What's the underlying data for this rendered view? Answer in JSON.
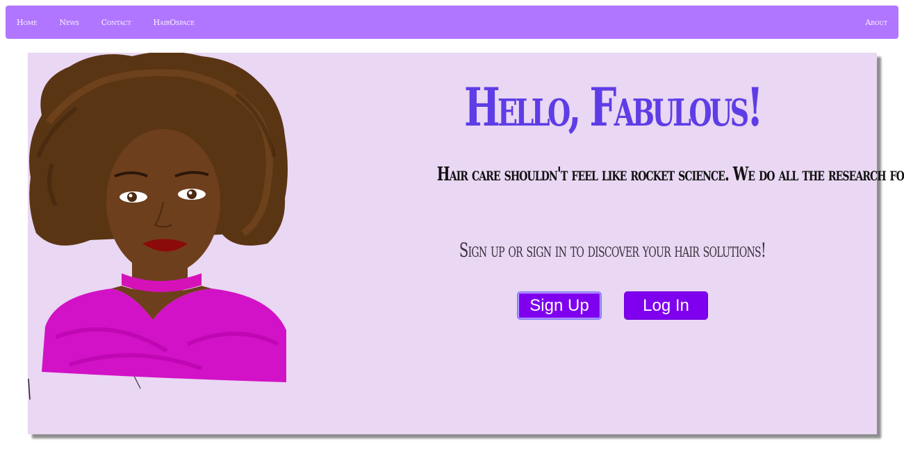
{
  "nav": {
    "links": [
      "Home",
      "News",
      "Contact",
      "HairOspace"
    ],
    "about": "About"
  },
  "hero": {
    "title": "Hello, Fabulous!",
    "subtitle": "Hair care shouldn't feel like rocket science. We do all the research for you!",
    "prompt": "Sign up or sign in to discover your hair solutions!",
    "signup_label": "Sign Up",
    "login_label": "Log In"
  },
  "colors": {
    "navbar": "#b176ff",
    "hero_bg": "#e9d7f3",
    "title": "#5e3de6",
    "button": "#7f00ee"
  },
  "icons": {
    "illustration": "woman-with-afro-portrait"
  }
}
